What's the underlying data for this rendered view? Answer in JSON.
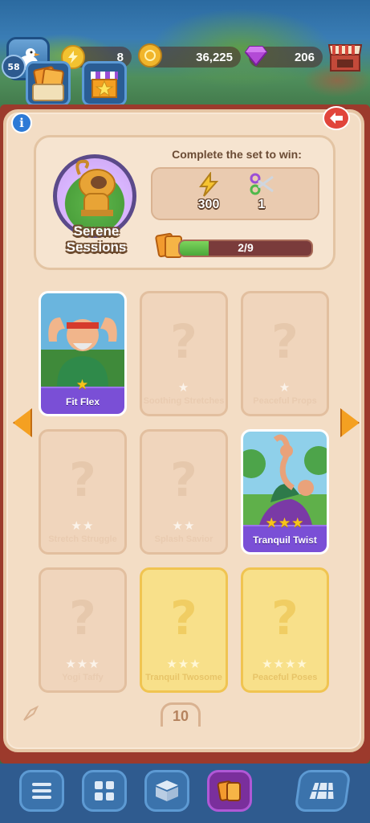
{
  "hud": {
    "player_level": "58",
    "energy": "8",
    "coins": "36,225",
    "gems": "206"
  },
  "set": {
    "name_line1": "Serene",
    "name_line2": "Sessions",
    "reward_title": "Complete the set to win:",
    "rewards": [
      {
        "icon": "energy-bolt-icon",
        "value": "300"
      },
      {
        "icon": "scissors-icon",
        "value": "1"
      }
    ],
    "progress_text": "2/9",
    "progress_fraction": 0.22
  },
  "cards": [
    {
      "name": "Fit Flex",
      "stars": "★",
      "state": "owned",
      "art": "man-flexing"
    },
    {
      "name": "Soothing Stretches",
      "stars": "★",
      "state": "missing"
    },
    {
      "name": "Peaceful Props",
      "stars": "★",
      "state": "missing"
    },
    {
      "name": "Stretch Struggle",
      "stars": "★★",
      "state": "missing"
    },
    {
      "name": "Splash Savior",
      "stars": "★★",
      "state": "missing"
    },
    {
      "name": "Tranquil Twist",
      "stars": "★★★",
      "state": "owned",
      "art": "yoga-pair"
    },
    {
      "name": "Yogi Taffy",
      "stars": "★★★",
      "state": "missing"
    },
    {
      "name": "Tranquil Twosome",
      "stars": "★★★",
      "state": "gold"
    },
    {
      "name": "Peaceful Poses",
      "stars": "★★★★",
      "state": "gold"
    }
  ],
  "page_number": "10",
  "colors": {
    "book": "#f3ddc5",
    "owned_banner": "#7a4fd6",
    "gold_card": "#f8e08a",
    "progress_fill": "#4aa83a",
    "back_button": "#e1453b"
  }
}
